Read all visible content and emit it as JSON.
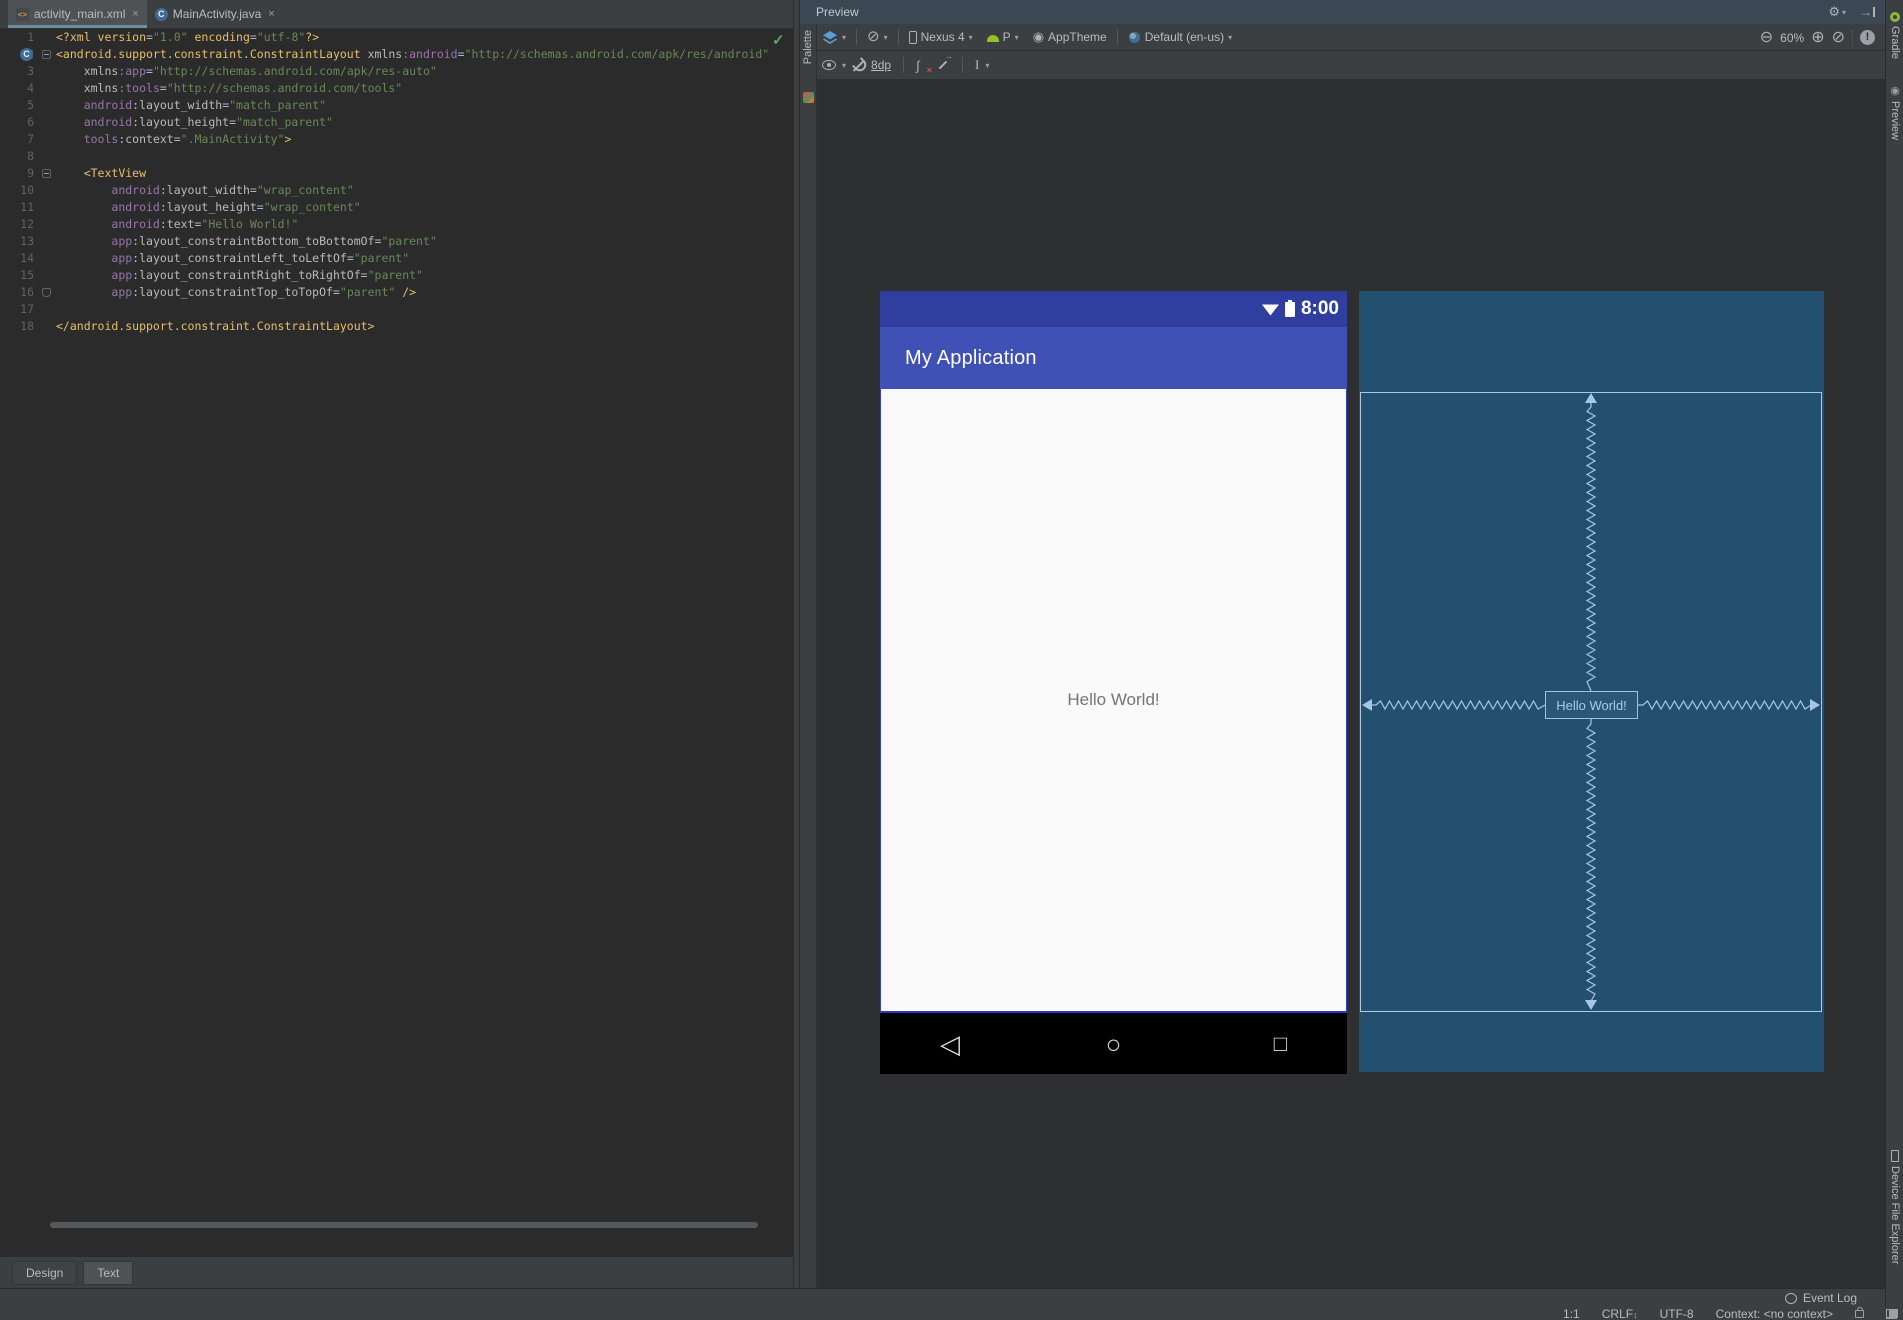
{
  "tabs": [
    {
      "label": "activity_main.xml",
      "close": "×",
      "selected": true
    },
    {
      "label": "MainActivity.java",
      "close": "×",
      "selected": false
    }
  ],
  "editor": {
    "lines": [
      {
        "num": 1,
        "segments": [
          [
            "tag",
            "<?xml "
          ],
          [
            "tag",
            "version"
          ],
          [
            "plain",
            "="
          ],
          [
            "val",
            "\"1.0\""
          ],
          [
            "tag",
            " encoding"
          ],
          [
            "plain",
            "="
          ],
          [
            "val",
            "\"utf-8\""
          ],
          [
            "tag",
            "?>"
          ]
        ]
      },
      {
        "num": 2,
        "fold": "start",
        "segments": [
          [
            "tag",
            "<android.support.constraint.ConstraintLayout"
          ],
          [
            "plain",
            " "
          ],
          [
            "attr",
            "xmlns"
          ],
          [
            "ns",
            ":android"
          ],
          [
            "plain",
            "="
          ],
          [
            "val",
            "\"http://schemas.android.com/apk/res/android\""
          ]
        ]
      },
      {
        "num": 3,
        "segments": [
          [
            "plain",
            "    "
          ],
          [
            "attr",
            "xmlns"
          ],
          [
            "ns",
            ":app"
          ],
          [
            "plain",
            "="
          ],
          [
            "val",
            "\"http://schemas.android.com/apk/res-auto\""
          ]
        ]
      },
      {
        "num": 4,
        "segments": [
          [
            "plain",
            "    "
          ],
          [
            "attr",
            "xmlns"
          ],
          [
            "ns",
            ":tools"
          ],
          [
            "plain",
            "="
          ],
          [
            "val",
            "\"http://schemas.android.com/tools\""
          ]
        ]
      },
      {
        "num": 5,
        "segments": [
          [
            "plain",
            "    "
          ],
          [
            "ns",
            "android"
          ],
          [
            "attr",
            ":layout_width"
          ],
          [
            "plain",
            "="
          ],
          [
            "val",
            "\"match_parent\""
          ]
        ]
      },
      {
        "num": 6,
        "segments": [
          [
            "plain",
            "    "
          ],
          [
            "ns",
            "android"
          ],
          [
            "attr",
            ":layout_height"
          ],
          [
            "plain",
            "="
          ],
          [
            "val",
            "\"match_parent\""
          ]
        ]
      },
      {
        "num": 7,
        "segments": [
          [
            "plain",
            "    "
          ],
          [
            "ns",
            "tools"
          ],
          [
            "attr",
            ":context"
          ],
          [
            "plain",
            "="
          ],
          [
            "val",
            "\".MainActivity\""
          ],
          [
            "tag",
            ">"
          ]
        ]
      },
      {
        "num": 8,
        "segments": []
      },
      {
        "num": 9,
        "fold": "start",
        "segments": [
          [
            "plain",
            "    "
          ],
          [
            "tag",
            "<TextView"
          ]
        ]
      },
      {
        "num": 10,
        "segments": [
          [
            "plain",
            "        "
          ],
          [
            "ns",
            "android"
          ],
          [
            "attr",
            ":layout_width"
          ],
          [
            "plain",
            "="
          ],
          [
            "val",
            "\"wrap_content\""
          ]
        ]
      },
      {
        "num": 11,
        "segments": [
          [
            "plain",
            "        "
          ],
          [
            "ns",
            "android"
          ],
          [
            "attr",
            ":layout_height"
          ],
          [
            "plain",
            "="
          ],
          [
            "val",
            "\"wrap_content\""
          ]
        ]
      },
      {
        "num": 12,
        "segments": [
          [
            "plain",
            "        "
          ],
          [
            "ns",
            "android"
          ],
          [
            "attr",
            ":text"
          ],
          [
            "plain",
            "="
          ],
          [
            "val",
            "\"Hello World!\""
          ]
        ]
      },
      {
        "num": 13,
        "segments": [
          [
            "plain",
            "        "
          ],
          [
            "ns",
            "app"
          ],
          [
            "attr",
            ":layout_constraintBottom_toBottomOf"
          ],
          [
            "plain",
            "="
          ],
          [
            "val",
            "\"parent\""
          ]
        ]
      },
      {
        "num": 14,
        "segments": [
          [
            "plain",
            "        "
          ],
          [
            "ns",
            "app"
          ],
          [
            "attr",
            ":layout_constraintLeft_toLeftOf"
          ],
          [
            "plain",
            "="
          ],
          [
            "val",
            "\"parent\""
          ]
        ]
      },
      {
        "num": 15,
        "segments": [
          [
            "plain",
            "        "
          ],
          [
            "ns",
            "app"
          ],
          [
            "attr",
            ":layout_constraintRight_toRightOf"
          ],
          [
            "plain",
            "="
          ],
          [
            "val",
            "\"parent\""
          ]
        ]
      },
      {
        "num": 16,
        "fold": "end",
        "segments": [
          [
            "plain",
            "        "
          ],
          [
            "ns",
            "app"
          ],
          [
            "attr",
            ":layout_constraintTop_toTopOf"
          ],
          [
            "plain",
            "="
          ],
          [
            "val",
            "\"parent\""
          ],
          [
            "plain",
            " "
          ],
          [
            "tag",
            "/>"
          ]
        ]
      },
      {
        "num": 17,
        "segments": []
      },
      {
        "num": 18,
        "segments": [
          [
            "tag",
            "</android.support.constraint.ConstraintLayout>"
          ]
        ]
      }
    ],
    "gutter_class_letter": "C",
    "inspection_check": "✓"
  },
  "bottom_tabs": {
    "design": "Design",
    "text": "Text"
  },
  "preview": {
    "title": "Preview",
    "toolbar": {
      "device": "Nexus 4",
      "api_level": "P",
      "theme": "AppTheme",
      "locale": "Default (en-us)",
      "zoom_level": "60%",
      "margin": "8dp",
      "infer_label": "I"
    }
  },
  "device": {
    "time": "8:00",
    "app_title": "My Application",
    "content_text": "Hello World!"
  },
  "blueprint": {
    "label": "Hello World!"
  },
  "strips": {
    "palette": "Palette",
    "gradle": "Gradle",
    "preview": "Preview",
    "device_file_explorer": "Device File Explorer"
  },
  "statusbar": {
    "event_log": "Event Log",
    "position": "1:1",
    "line_ending": "CRLF",
    "encoding": "UTF-8",
    "context": "Context: <no context>"
  },
  "colors": {
    "primary": "#3F51B5",
    "primary_dark": "#303F9F",
    "editor_bg": "#2B2B2B",
    "blueprint_bg": "#24506F",
    "blueprint_line": "#A5C8E2",
    "xml_tag": "#E8BF6A",
    "xml_value": "#6A8759",
    "xml_namespace": "#9876AA"
  }
}
